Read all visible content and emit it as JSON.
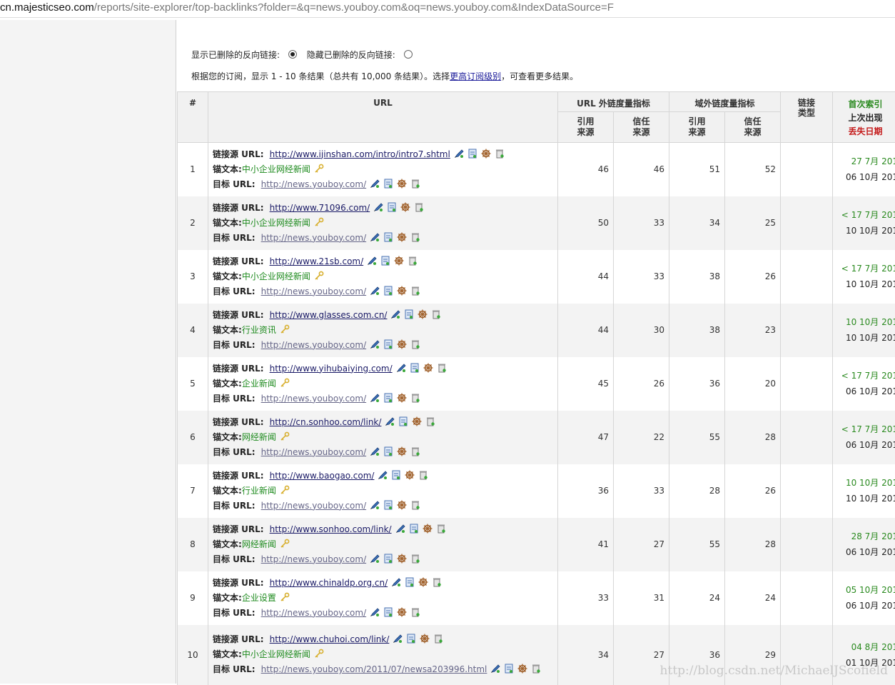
{
  "address_bar": {
    "host": "cn.majesticseo.com",
    "path": "/reports/site-explorer/top-backlinks?folder=&q=news.youboy.com&oq=news.youboy.com&IndexDataSource=F"
  },
  "options": {
    "show_deleted_label": "显示已删除的反向链接:",
    "hide_deleted_label": "隐藏已删除的反向链接:",
    "selected": "show"
  },
  "notice": {
    "prefix": "根据您的订阅，显示 1 - 10 条结果（总共有 10,000 条结果）。选择",
    "link": "更高订阅级别",
    "suffix": "，可查看更多结果。"
  },
  "table": {
    "col_index": "#",
    "col_url": "URL",
    "group_url_metrics": "URL 外链度量指标",
    "group_domain_metrics": "域外链度量指标",
    "col_link_type": "链接类型",
    "sub_ref": "引用来源",
    "sub_trust": "信任来源",
    "date_first": "首次索引",
    "date_last": "上次出现",
    "date_lost": "丢失日期",
    "label_source": "链接源 URL:",
    "label_anchor": "锚文本:",
    "label_target": "目标 URL:",
    "rows": [
      {
        "idx": "1",
        "source": "http://www.ijinshan.com/intro/intro7.shtml",
        "anchor": "中小企业网经新闻",
        "target": "http://news.youboy.com/",
        "url_ref": "46",
        "url_trust": "46",
        "dom_ref": "51",
        "dom_trust": "52",
        "first": "27 7月 201",
        "last": "06 10月 201",
        "first_color": "green"
      },
      {
        "idx": "2",
        "source": "http://www.71096.com/",
        "anchor": "中小企业网经新闻",
        "target": "http://news.youboy.com/",
        "url_ref": "50",
        "url_trust": "33",
        "dom_ref": "34",
        "dom_trust": "25",
        "first": "< 17 7月 201",
        "last": "10 10月 201",
        "first_color": "green"
      },
      {
        "idx": "3",
        "source": "http://www.21sb.com/",
        "anchor": "中小企业网经新闻",
        "target": "http://news.youboy.com/",
        "url_ref": "44",
        "url_trust": "33",
        "dom_ref": "38",
        "dom_trust": "26",
        "first": "< 17 7月 201",
        "last": "10 10月 201",
        "first_color": "green"
      },
      {
        "idx": "4",
        "source": "http://www.glasses.com.cn/",
        "anchor": "行业资讯",
        "target": "http://news.youboy.com/",
        "url_ref": "44",
        "url_trust": "30",
        "dom_ref": "38",
        "dom_trust": "23",
        "first": "10 10月 201",
        "last": "10 10月 201",
        "first_color": "green"
      },
      {
        "idx": "5",
        "source": "http://www.yihubaiying.com/",
        "anchor": "企业新闻",
        "target": "http://news.youboy.com/",
        "url_ref": "45",
        "url_trust": "26",
        "dom_ref": "36",
        "dom_trust": "20",
        "first": "< 17 7月 201",
        "last": "06 10月 201",
        "first_color": "green"
      },
      {
        "idx": "6",
        "source": "http://cn.sonhoo.com/link/",
        "anchor": "网经新闻",
        "target": "http://news.youboy.com/",
        "url_ref": "47",
        "url_trust": "22",
        "dom_ref": "55",
        "dom_trust": "28",
        "first": "< 17 7月 201",
        "last": "06 10月 201",
        "first_color": "green"
      },
      {
        "idx": "7",
        "source": "http://www.baogao.com/",
        "anchor": "行业新闻",
        "target": "http://news.youboy.com/",
        "url_ref": "36",
        "url_trust": "33",
        "dom_ref": "28",
        "dom_trust": "26",
        "first": "10 10月 201",
        "last": "10 10月 201",
        "first_color": "green"
      },
      {
        "idx": "8",
        "source": "http://www.sonhoo.com/link/",
        "anchor": "网经新闻",
        "target": "http://news.youboy.com/",
        "url_ref": "41",
        "url_trust": "27",
        "dom_ref": "55",
        "dom_trust": "28",
        "first": "28 7月 201",
        "last": "06 10月 201",
        "first_color": "green"
      },
      {
        "idx": "9",
        "source": "http://www.chinaldp.org.cn/",
        "anchor": "企业设置",
        "target": "http://news.youboy.com/",
        "url_ref": "33",
        "url_trust": "31",
        "dom_ref": "24",
        "dom_trust": "24",
        "first": "05 10月 201",
        "last": "06 10月 201",
        "first_color": "green"
      },
      {
        "idx": "10",
        "source": "http://www.chuhoi.com/link/",
        "anchor": "中小企业网经新闻",
        "target": "http://news.youboy.com/2011/07/newsa203996.html",
        "url_ref": "34",
        "url_trust": "27",
        "dom_ref": "36",
        "dom_trust": "29",
        "first": "04 8月 201",
        "last": "01 10月 201",
        "first_color": "green"
      }
    ]
  },
  "colors": {
    "green": "#2a8a1f",
    "lost_red": "#c41a1a",
    "header_bg": "#f1f1f1"
  },
  "icons": [
    "pencil-link-icon",
    "page-icon",
    "wheel-icon",
    "bin-icon",
    "key-icon"
  ],
  "watermark": "http://blog.csdn.net/MichaelJScofield"
}
